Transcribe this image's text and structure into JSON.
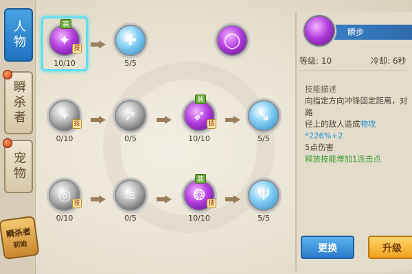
{
  "tabs": [
    {
      "label": "人物",
      "active": true
    },
    {
      "label": "瞬杀者",
      "active": false
    },
    {
      "label": "宠物",
      "active": false
    }
  ],
  "class_badge": {
    "name": "瞬杀者",
    "sub": "初始"
  },
  "tree": {
    "row1": [
      {
        "icon": "purple-slash-icon",
        "count": "10/10",
        "equip": "装",
        "skill": "技"
      },
      {
        "icon": "boot-plus-icon",
        "count": "5/5"
      },
      {
        "icon": "purple-ring-icon",
        "count": ""
      }
    ],
    "row2": [
      {
        "icon": "gray-slash-icon",
        "count": "0/10",
        "skill": "技"
      },
      {
        "icon": "cursor-plus-icon",
        "count": "0/5"
      },
      {
        "icon": "purple-dash-icon",
        "count": "10/10",
        "equip": "装",
        "skill": "技"
      },
      {
        "icon": "arrow-down-icon",
        "count": "5/5"
      }
    ],
    "row3": [
      {
        "icon": "gray-swirl-icon",
        "count": "0/10",
        "skill": "技"
      },
      {
        "icon": "feather-icon",
        "count": "0/5"
      },
      {
        "icon": "purple-vortex-icon",
        "count": "10/10",
        "equip": "装",
        "skill": "技"
      },
      {
        "icon": "trident-icon",
        "count": "5/5"
      }
    ]
  },
  "detail": {
    "name": "瞬步",
    "level_label": "等级:",
    "level_value": "10",
    "cooldown_label": "冷却:",
    "cooldown_value": "6秒",
    "desc_title": "技能描述",
    "desc_line1": "向指定方向冲锋固定距离，对路",
    "desc_line2": "径上的敌人造成",
    "desc_highlight": "物攻*226%+2",
    "desc_line3": "5点伤害",
    "desc_bonus": "释放技能增加1连击点"
  },
  "buttons": {
    "change": "更换",
    "upgrade": "升级"
  }
}
